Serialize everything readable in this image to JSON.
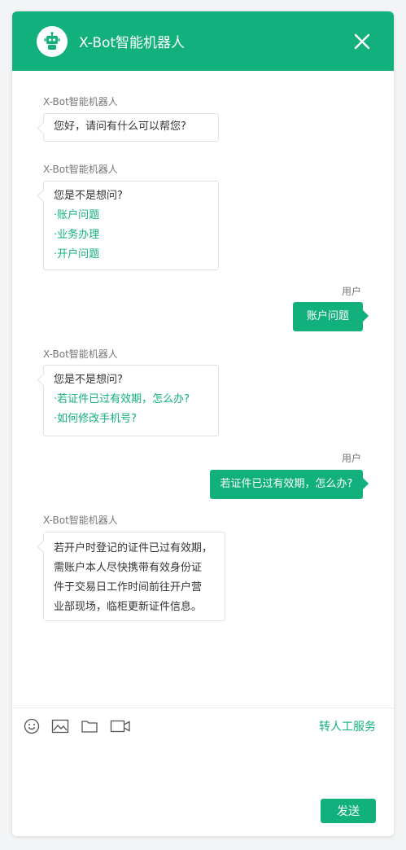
{
  "header": {
    "title": "X-Bot智能机器人"
  },
  "chat": {
    "messages": [
      {
        "sender": "X-Bot智能机器人",
        "lines": [
          "您好，请问有什么可以帮您?"
        ]
      },
      {
        "sender": "X-Bot智能机器人",
        "text": "您是不是想问?",
        "options": [
          "·账户问题",
          "·业务办理",
          "·开户问题"
        ]
      },
      {
        "sender": "用户",
        "text": "账户问题"
      },
      {
        "sender": "X-Bot智能机器人",
        "text": "您是不是想问?",
        "options": [
          "·若证件已过有效期，怎么办?",
          "·如何修改手机号?"
        ]
      },
      {
        "sender": "用户",
        "text": "若证件已过有效期，怎么办?"
      },
      {
        "sender": "X-Bot智能机器人",
        "lines": [
          "若开户时登记的证件已过有效期，",
          "需账户本人尽快携带有效身份证",
          "件于交易日工作时间前往开户营",
          "业部现场，临柜更新证件信息。"
        ]
      }
    ]
  },
  "toolbar": {
    "transfer_label": "转人工服务",
    "send_label": "发送"
  },
  "icons": [
    "robot-icon",
    "close-icon",
    "emoji-icon",
    "image-icon",
    "folder-icon",
    "video-icon"
  ],
  "colors": {
    "accent": "#12b07c"
  }
}
